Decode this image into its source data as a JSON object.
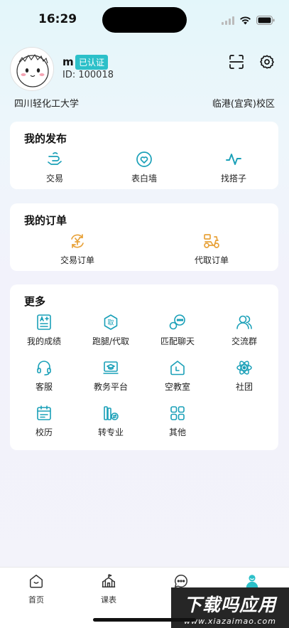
{
  "status": {
    "time": "16:29"
  },
  "profile": {
    "name": "m",
    "badge": "已认证",
    "id_text": "ID: 100018",
    "school": "四川轻化工大学",
    "campus": "临港(宜宾)校区"
  },
  "my_posts": {
    "title": "我的发布",
    "items": [
      {
        "label": "交易",
        "icon": "trade-hand-icon"
      },
      {
        "label": "表白墙",
        "icon": "heart-icon"
      },
      {
        "label": "找搭子",
        "icon": "pulse-icon"
      }
    ]
  },
  "my_orders": {
    "title": "我的订单",
    "items": [
      {
        "label": "交易订单",
        "icon": "yen-cycle-icon"
      },
      {
        "label": "代取订单",
        "icon": "scooter-icon"
      }
    ]
  },
  "more": {
    "title": "更多",
    "items": [
      {
        "label": "我的成绩",
        "icon": "grade-icon"
      },
      {
        "label": "跑腿/代取",
        "icon": "errand-icon"
      },
      {
        "label": "匹配聊天",
        "icon": "chat-match-icon"
      },
      {
        "label": "交流群",
        "icon": "group-icon"
      },
      {
        "label": "客服",
        "icon": "headset-icon"
      },
      {
        "label": "教务平台",
        "icon": "academic-icon"
      },
      {
        "label": "空教室",
        "icon": "classroom-icon"
      },
      {
        "label": "社团",
        "icon": "atom-icon"
      },
      {
        "label": "校历",
        "icon": "calendar-icon"
      },
      {
        "label": "转专业",
        "icon": "books-icon"
      },
      {
        "label": "其他",
        "icon": "apps-icon"
      }
    ]
  },
  "tabbar": [
    {
      "label": "首页",
      "icon": "home-icon"
    },
    {
      "label": "课表",
      "icon": "school-icon"
    },
    {
      "label": "",
      "icon": "message-icon"
    },
    {
      "label": "",
      "icon": "profile-icon"
    }
  ],
  "watermark": {
    "big": "下载吗应用",
    "small": "www.xiazaimao.com"
  },
  "colors": {
    "accent": "#2cc0c9",
    "orange": "#e8a23a",
    "teal_icon": "#1aa0b8"
  }
}
